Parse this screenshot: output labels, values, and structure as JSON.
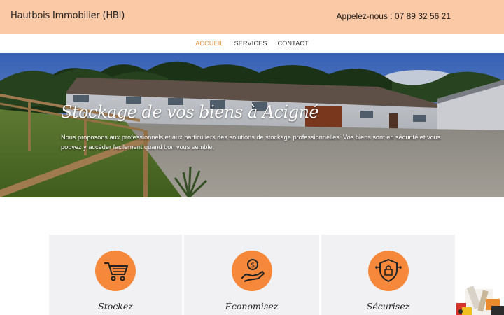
{
  "header": {
    "brand": "Hautbois Immobilier (HBI)",
    "phone": "Appelez-nous : 07 89 32 56 21"
  },
  "nav": {
    "items": [
      {
        "label": "ACCUEIL",
        "active": true
      },
      {
        "label": "SERVICES",
        "active": false
      },
      {
        "label": "CONTACT",
        "active": false
      }
    ]
  },
  "hero": {
    "title": "Stockage de vos biens à Acigné",
    "text": "Nous proposons aux professionnels et aux particuliers des solutions de stockage professionnelles. Vos biens sont en sécurité et vous pouvez y accéder facilement quand bon vous semble."
  },
  "features": [
    {
      "title": "Stockez",
      "icon": "shopping-cart-icon"
    },
    {
      "title": "Économisez",
      "icon": "money-hand-icon"
    },
    {
      "title": "Sécurisez",
      "icon": "security-shield-icon"
    }
  ],
  "colors": {
    "header_bg": "#fcc9a6",
    "accent": "#e5943f",
    "icon_circle": "#f5883a",
    "card_bg": "#f1f1f3"
  }
}
